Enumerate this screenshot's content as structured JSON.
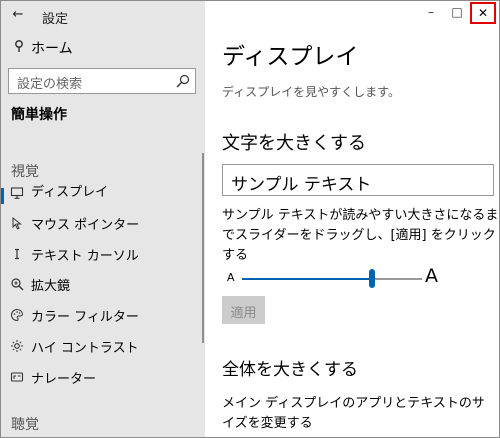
{
  "window": {
    "title": "設定",
    "back_glyph": "←",
    "minimize_glyph": "–",
    "maximize_glyph": "□",
    "close_glyph": "✕",
    "close_highlight_color": "#e00000"
  },
  "sidebar": {
    "home_label": "ホーム",
    "search_placeholder": "設定の検索",
    "section_title": "簡単操作",
    "category_vision": "視覚",
    "category_hearing": "聴覚",
    "accent_color": "#0063b1",
    "items": [
      {
        "label": "ディスプレイ",
        "icon": "monitor-icon",
        "selected": true
      },
      {
        "label": "マウス ポインター",
        "icon": "pointer-icon"
      },
      {
        "label": "テキスト カーソル",
        "icon": "text-cursor-icon"
      },
      {
        "label": "拡大鏡",
        "icon": "magnifier-icon"
      },
      {
        "label": "カラー フィルター",
        "icon": "palette-icon"
      },
      {
        "label": "ハイ コントラスト",
        "icon": "sun-icon"
      },
      {
        "label": "ナレーター",
        "icon": "narrator-icon"
      }
    ]
  },
  "main": {
    "page_title": "ディスプレイ",
    "page_description": "ディスプレイを見やすくします。",
    "text_size_heading": "文字を大きくする",
    "sample_text": "サンプル テキスト",
    "slider_description": "サンプル テキストが読みやすい大きさになるまでスライダーをドラッグし、[適用] をクリックする",
    "slider_small_label": "A",
    "slider_big_label": "A",
    "slider_value_fraction": 0.72,
    "apply_label": "適用",
    "everything_heading": "全体を大きくする",
    "everything_description": "メイン ディスプレイのアプリとテキストのサイズを変更する"
  }
}
